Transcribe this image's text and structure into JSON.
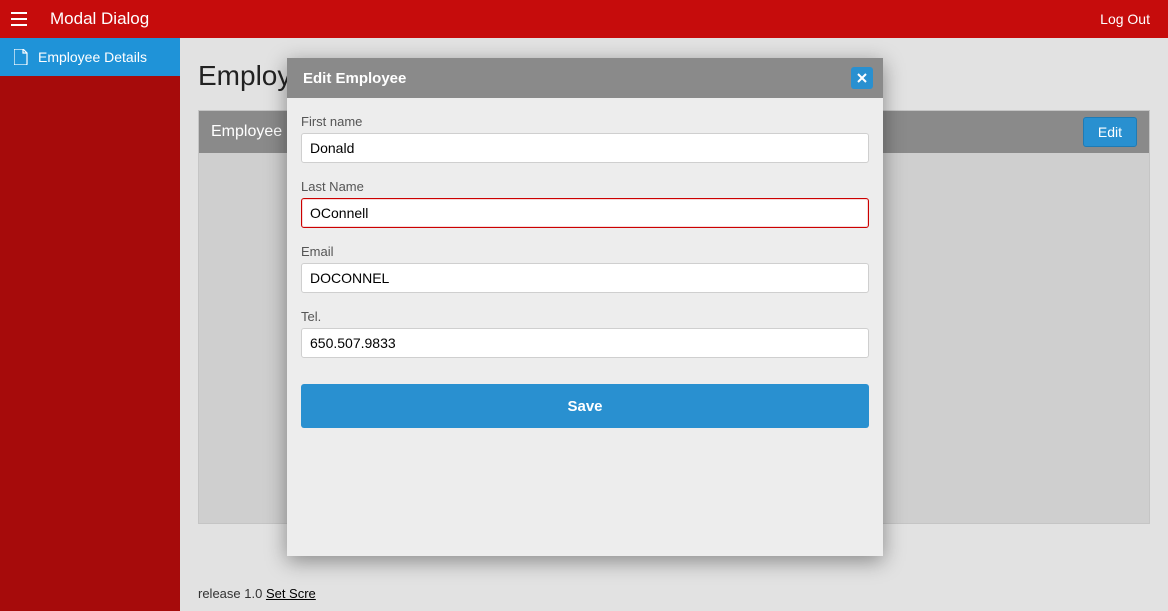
{
  "header": {
    "app_title": "Modal Dialog",
    "logout_label": "Log Out"
  },
  "sidebar": {
    "items": [
      {
        "label": "Employee Details"
      }
    ]
  },
  "page": {
    "title": "Employ",
    "panel_title": "Employee",
    "edit_button_label": "Edit"
  },
  "footer": {
    "release_text": "release 1.0 ",
    "link_text": "Set Scre"
  },
  "modal": {
    "title": "Edit Employee",
    "save_label": "Save",
    "fields": {
      "first_name": {
        "label": "First name",
        "value": "Donald"
      },
      "last_name": {
        "label": "Last Name",
        "value": "OConnell"
      },
      "email": {
        "label": "Email",
        "value": "DOCONNEL"
      },
      "tel": {
        "label": "Tel.",
        "value": "650.507.9833"
      }
    }
  },
  "colors": {
    "brand_red": "#c60c0c",
    "sidebar_red": "#a60b0b",
    "primary_blue": "#2990d0"
  }
}
